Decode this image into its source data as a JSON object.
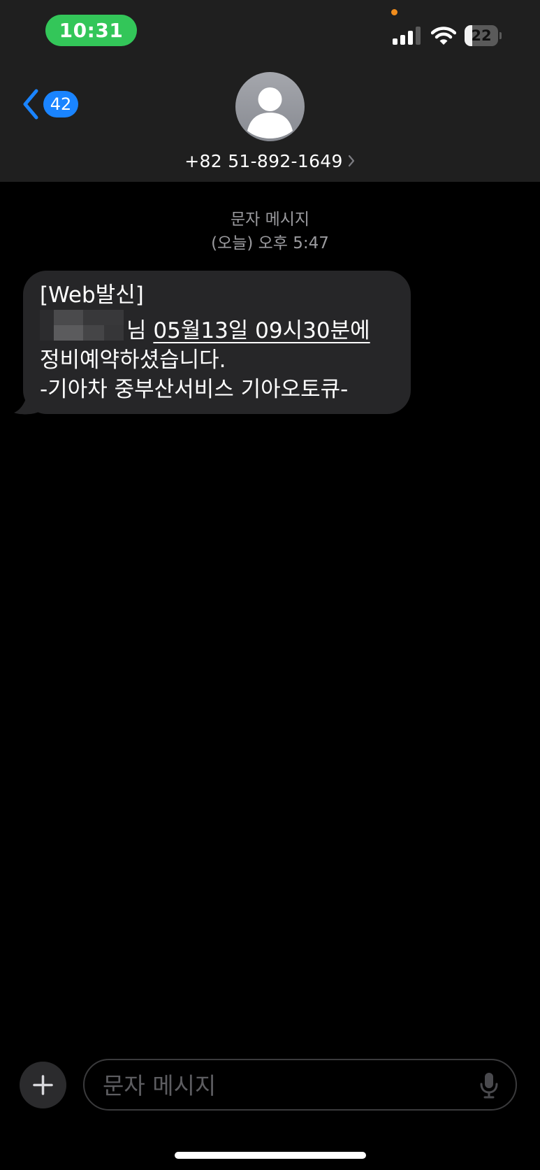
{
  "status_bar": {
    "time": "10:31",
    "battery_level": "22",
    "battery_fraction": 0.22
  },
  "header": {
    "unread_count": "42",
    "contact_number": "+82 51-892-1649"
  },
  "conversation": {
    "service_label": "문자 메시지",
    "timestamp": "(오늘) 오후 5:47",
    "message": {
      "line1": "[Web발신]",
      "line2_tail_fragment": "님",
      "line2_date_link": "05월13일 09시30분에",
      "line3": "정비예약하셨습니다.",
      "line4": "-기아차 중부산서비스 기아오토큐-"
    }
  },
  "composer": {
    "placeholder": "문자 메시지"
  },
  "icons": {
    "back": "chevron-left-icon",
    "avatar": "person-silhouette-icon",
    "add": "plus-icon",
    "mic": "microphone-icon",
    "signal": "cellular-signal-icon",
    "wifi": "wifi-icon",
    "battery": "battery-icon"
  },
  "colors": {
    "status_pill": "#33c659",
    "accent_blue": "#1a84ff",
    "bubble": "#262628",
    "header_bg": "#1f1f1f",
    "meta_text": "#9b9b9f",
    "recording_dot": "#f08c1c"
  }
}
